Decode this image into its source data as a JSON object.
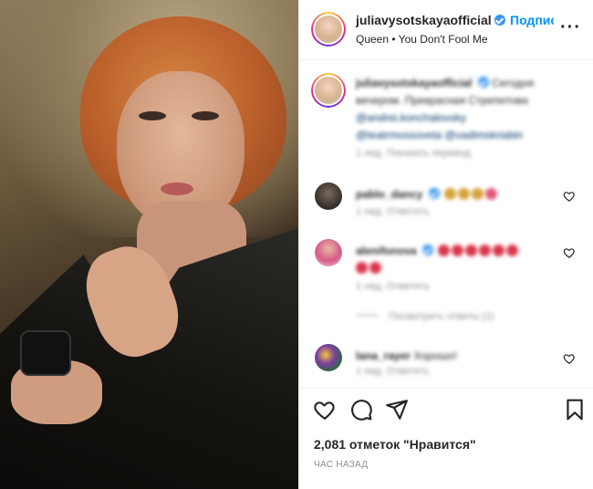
{
  "post": {
    "media": {
      "description_icon": "photo"
    },
    "header": {
      "username": "juliavysotskayaofficial",
      "separator": "•",
      "follow_label": "Подписаться",
      "song": "Queen • You Don't Fool Me",
      "more_icon": "more-horizontal-icon"
    },
    "caption": {
      "username": "juliavysotskayaofficial",
      "text": "Сегодня вечером. Прекрасная Стрепетова",
      "mentions": [
        "@andrei.konchalovsky",
        "@teatrmossoveta @vadimskriabin"
      ],
      "meta": "1 нед.   Показать перевод"
    },
    "comments": [
      {
        "username": "pablo_dancy",
        "text": "",
        "meta": "1 нед.   Ответить"
      },
      {
        "username": "alenifonova",
        "text": "",
        "meta": "1 нед.   Ответить"
      },
      {
        "username": "lana_rayer",
        "text": "Хорошо!",
        "meta": "1 нед.   Ответить"
      }
    ],
    "replies_label": "Посмотреть ответы (1)",
    "likes": "2,081 отметок \"Нравится\"",
    "time": "ЧАС НАЗАД"
  },
  "colors": {
    "accent": "#0095f6",
    "text": "#262626",
    "muted": "#8e8e8e",
    "verified": "#3897f0"
  }
}
